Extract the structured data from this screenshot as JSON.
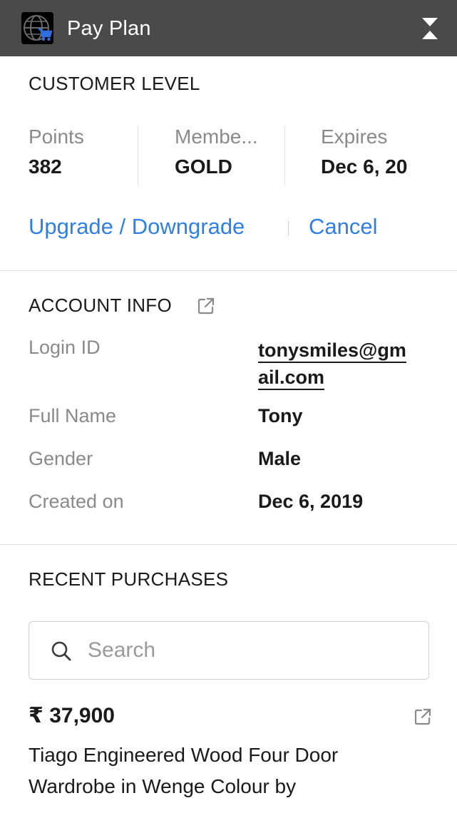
{
  "header": {
    "title": "Pay Plan",
    "app_icon": "globe-cart-icon",
    "collapse_icon": "collapse-icon"
  },
  "customer_level": {
    "heading": "CUSTOMER LEVEL",
    "stats": [
      {
        "label": "Points",
        "value": "382"
      },
      {
        "label": "Membe...",
        "value": "GOLD"
      },
      {
        "label": "Expires",
        "value": "Dec 6, 20"
      }
    ],
    "upgrade_label": "Upgrade / Downgrade",
    "cancel_label": "Cancel"
  },
  "account_info": {
    "heading": "ACCOUNT INFO",
    "external_icon": "external-link-icon",
    "rows": [
      {
        "label": "Login ID",
        "value": "tonysmiles@gmail.com"
      },
      {
        "label": "Full Name",
        "value": "Tony"
      },
      {
        "label": "Gender",
        "value": "Male"
      },
      {
        "label": "Created on",
        "value": "Dec 6, 2019"
      }
    ]
  },
  "recent_purchases": {
    "heading": "RECENT PURCHASES",
    "search_placeholder": "Search",
    "items": [
      {
        "price": "₹ 37,900",
        "title": "Tiago Engineered Wood Four Door Wardrobe in Wenge Colour by"
      }
    ]
  },
  "colors": {
    "header_bg": "#4a4a4a",
    "link": "#2f7fe6",
    "muted_text": "#8a8a8a"
  }
}
